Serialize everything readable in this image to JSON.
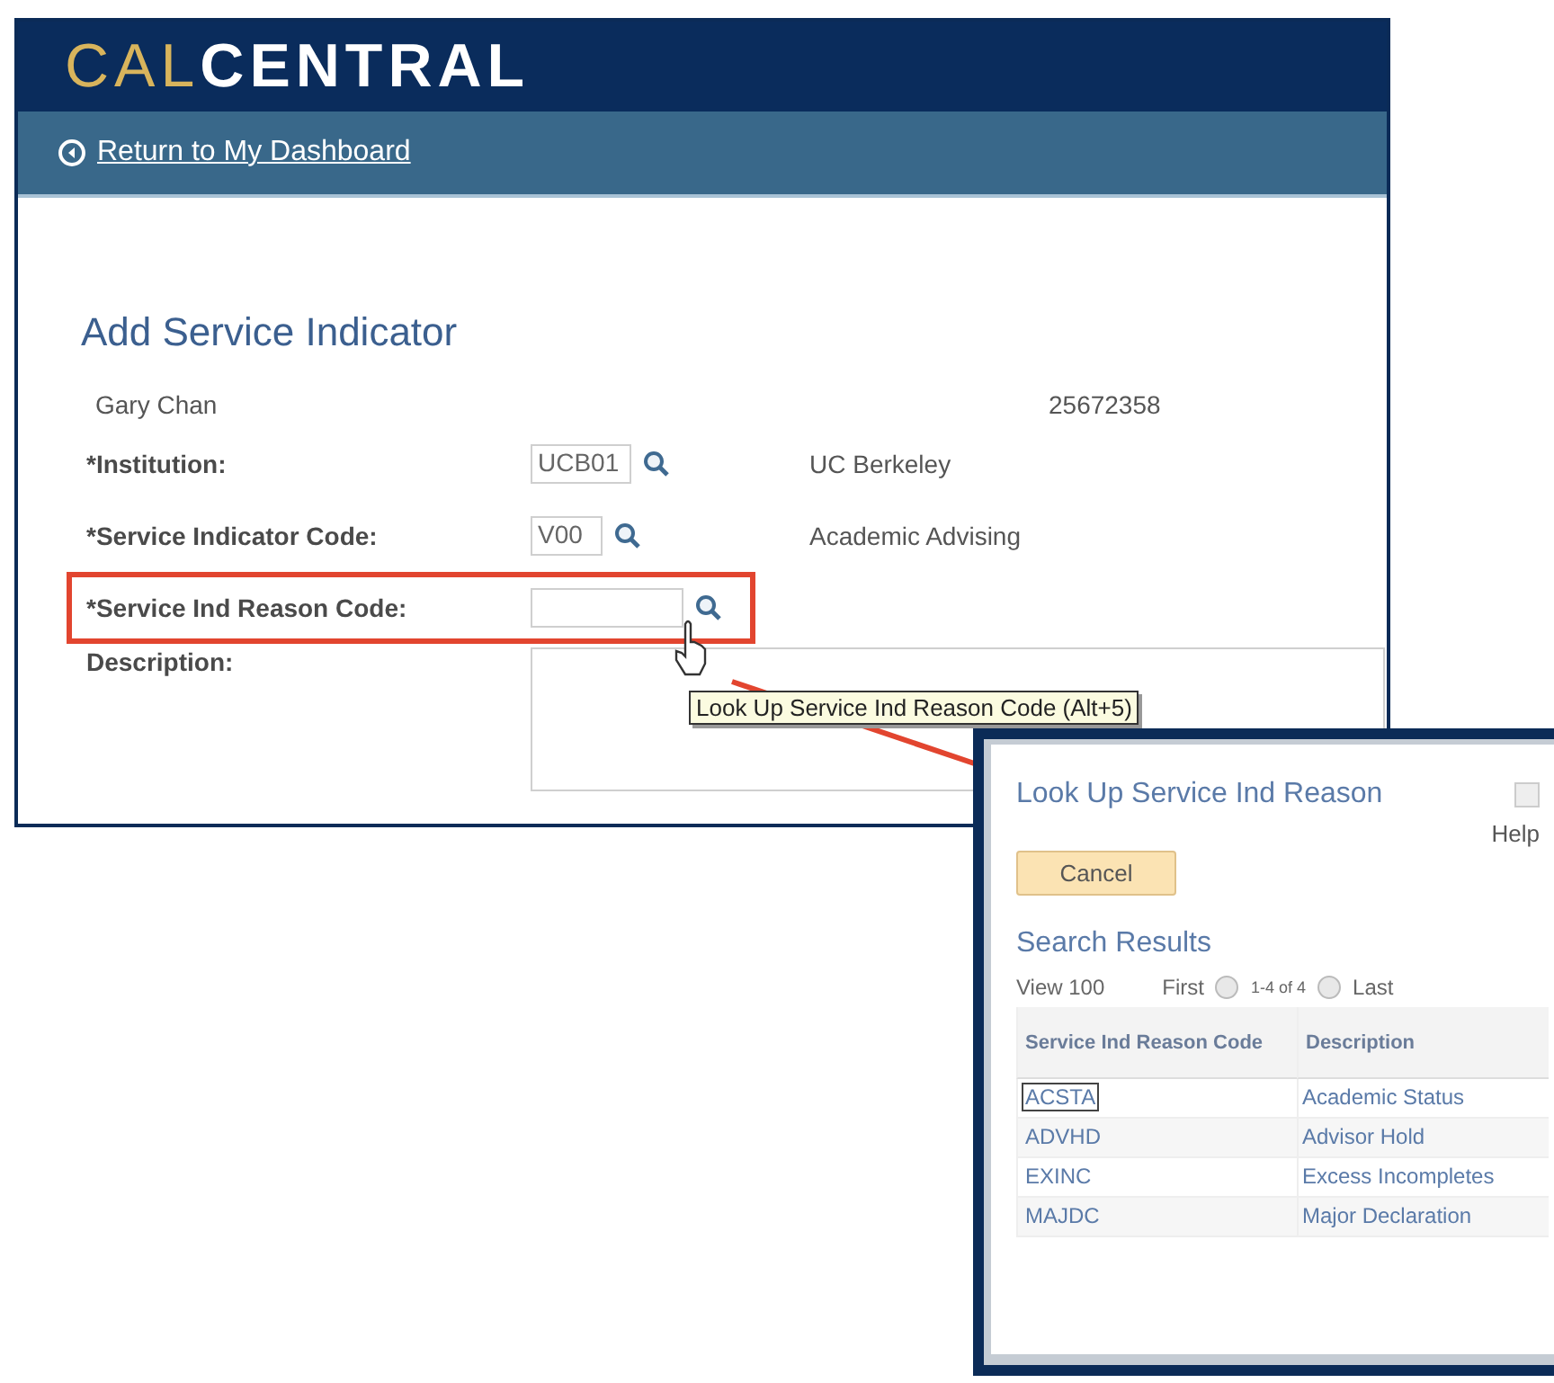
{
  "header": {
    "logo_part_1": "CAL",
    "logo_part_2": "CENTRAL"
  },
  "nav": {
    "link": "Return to My Dashboard"
  },
  "page": {
    "title": "Add Service Indicator",
    "name": "Gary Chan",
    "id": "25672358",
    "fields": [
      {
        "label": "*Institution:",
        "value": "UCB01",
        "description": "UC Berkeley",
        "highlighted": false
      },
      {
        "label": "*Service Indicator Code:",
        "value": "V00",
        "description": "Academic Advising",
        "highlighted": false
      },
      {
        "label": "*Service Ind Reason Code:",
        "highlighted": true
      }
    ],
    "description_label": "Description:"
  },
  "tooltip": "Look Up Service Ind Reason Code (Alt+5)",
  "lookup_dialog": {
    "title": "Look Up Service Ind Reason",
    "help": "Help",
    "cancel": "Cancel",
    "results_title": "Search Results",
    "view": "View 100",
    "first": "First",
    "range": "1-4 of 4",
    "last": "Last",
    "columns": [
      "Service Ind Reason Code",
      "Description"
    ],
    "rows": [
      {
        "code": "ACSTA",
        "description": "Academic Status",
        "focused": true
      },
      {
        "code": "ADVHD",
        "description": "Advisor Hold",
        "focused": false
      },
      {
        "code": "EXINC",
        "description": "Excess Incompletes",
        "focused": false
      },
      {
        "code": "MAJDC",
        "description": "Major Declaration",
        "focused": false
      }
    ]
  }
}
